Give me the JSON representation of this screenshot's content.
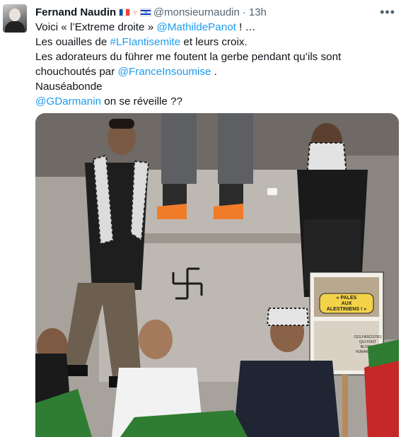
{
  "author": {
    "name": "Fernand Naudin",
    "flags": "🇫🇷🤍🇮🇱",
    "handle": "@monsieurnaudin",
    "separator": "·",
    "time": "13h",
    "avatar_icon": "profile-photo"
  },
  "more_glyph": "•••",
  "lines": [
    {
      "pre": "Voici « l’Extreme droite » ",
      "link": "@MathildePanot",
      "post": " ! …"
    },
    {
      "pre": "Les ouailles de ",
      "link": "#LFIantisemite",
      "post": " et leurs croix."
    },
    {
      "pre": "Les adorateurs du führer me foutent la gerbe pendant qu’ils sont",
      "link": "",
      "post": ""
    },
    {
      "pre": "chouchoutés par ",
      "link": "@FranceInsoumise",
      "post": " ."
    },
    {
      "pre": "Nauséabonde",
      "link": "",
      "post": ""
    },
    {
      "pre": "",
      "link": "@GDarmanin",
      "post": " on se réveille ??"
    }
  ],
  "media": {
    "sign_text_1": "« PALES",
    "sign_text_2": "AUX",
    "sign_text_3": "ALESTINIENS ! »",
    "sign_small_1": "CES FASCISTES",
    "sign_small_2": "QUI FONT",
    "sign_small_3": "BLOCUS",
    "sign_small_4": "HUMANITAIRE"
  },
  "colors": {
    "link": "#1d9bf0",
    "secondary_text": "#536471",
    "primary_text": "#0f1419"
  }
}
